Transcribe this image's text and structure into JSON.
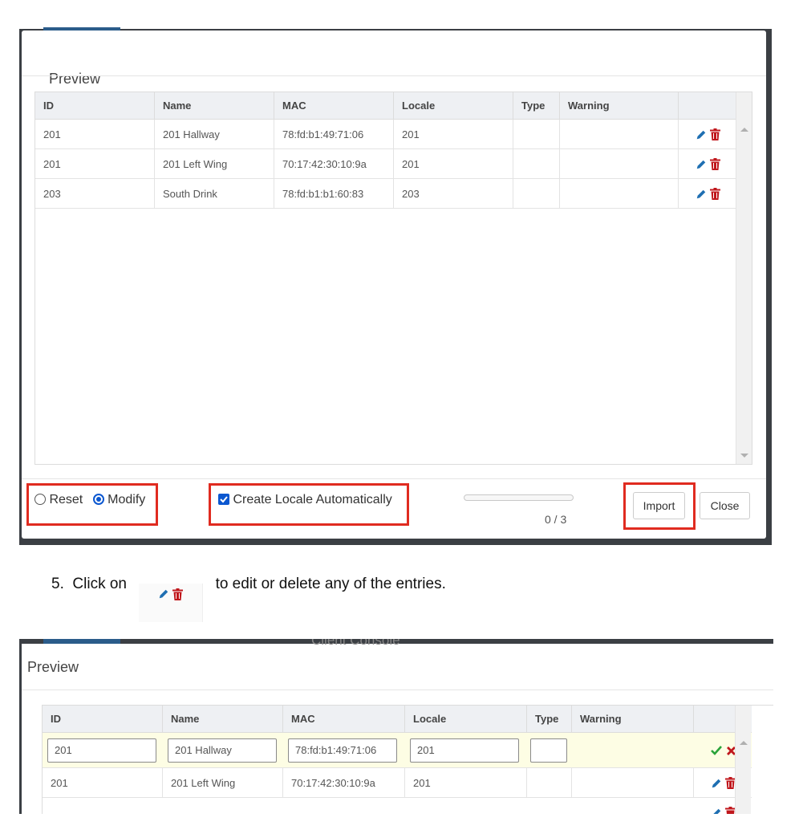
{
  "preview1": {
    "title": "Preview",
    "columns": [
      "ID",
      "Name",
      "MAC",
      "Locale",
      "Type",
      "Warning"
    ],
    "rows": [
      {
        "id": "201",
        "name": "201 Hallway",
        "mac": "78:fd:b1:49:71:06",
        "locale": "201",
        "type": "",
        "warning": ""
      },
      {
        "id": "201",
        "name": "201 Left Wing",
        "mac": "70:17:42:30:10:9a",
        "locale": "201",
        "type": "",
        "warning": ""
      },
      {
        "id": "203",
        "name": "South Drink",
        "mac": "78:fd:b1:b1:60:83",
        "locale": "203",
        "type": "",
        "warning": ""
      }
    ],
    "reset_label": "Reset",
    "modify_label": "Modify",
    "mode_selected": "Modify",
    "create_locale_label": "Create Locale Automatically",
    "create_locale_checked": true,
    "progress_fraction": 0,
    "progress_text": "0 / 3",
    "import_label": "Import",
    "close_label": "Close"
  },
  "instruction": {
    "number": "5.",
    "before": "Click on",
    "after": "to edit or delete any of the entries."
  },
  "preview2": {
    "title": "Preview",
    "clipped_heading": "Client Console",
    "columns": [
      "ID",
      "Name",
      "MAC",
      "Locale",
      "Type",
      "Warning"
    ],
    "edit_row": {
      "id": "201",
      "name": "201 Hallway",
      "mac": "78:fd:b1:49:71:06",
      "locale": "201",
      "type": ""
    },
    "rows": [
      {
        "id": "201",
        "name": "201 Left Wing",
        "mac": "70:17:42:30:10:9a",
        "locale": "201",
        "type": "",
        "warning": ""
      }
    ]
  },
  "icons": {
    "edit": "pencil-icon",
    "delete": "trash-icon",
    "confirm": "check-icon",
    "cancel": "x-icon"
  },
  "colors": {
    "highlight_box": "#e02b20",
    "edit_icon": "#1f6fb2",
    "delete_icon": "#c0171c",
    "confirm_icon": "#2aa33a",
    "edit_row_bg": "#fdfde4",
    "radio_checkbox": "#0b57d0"
  }
}
